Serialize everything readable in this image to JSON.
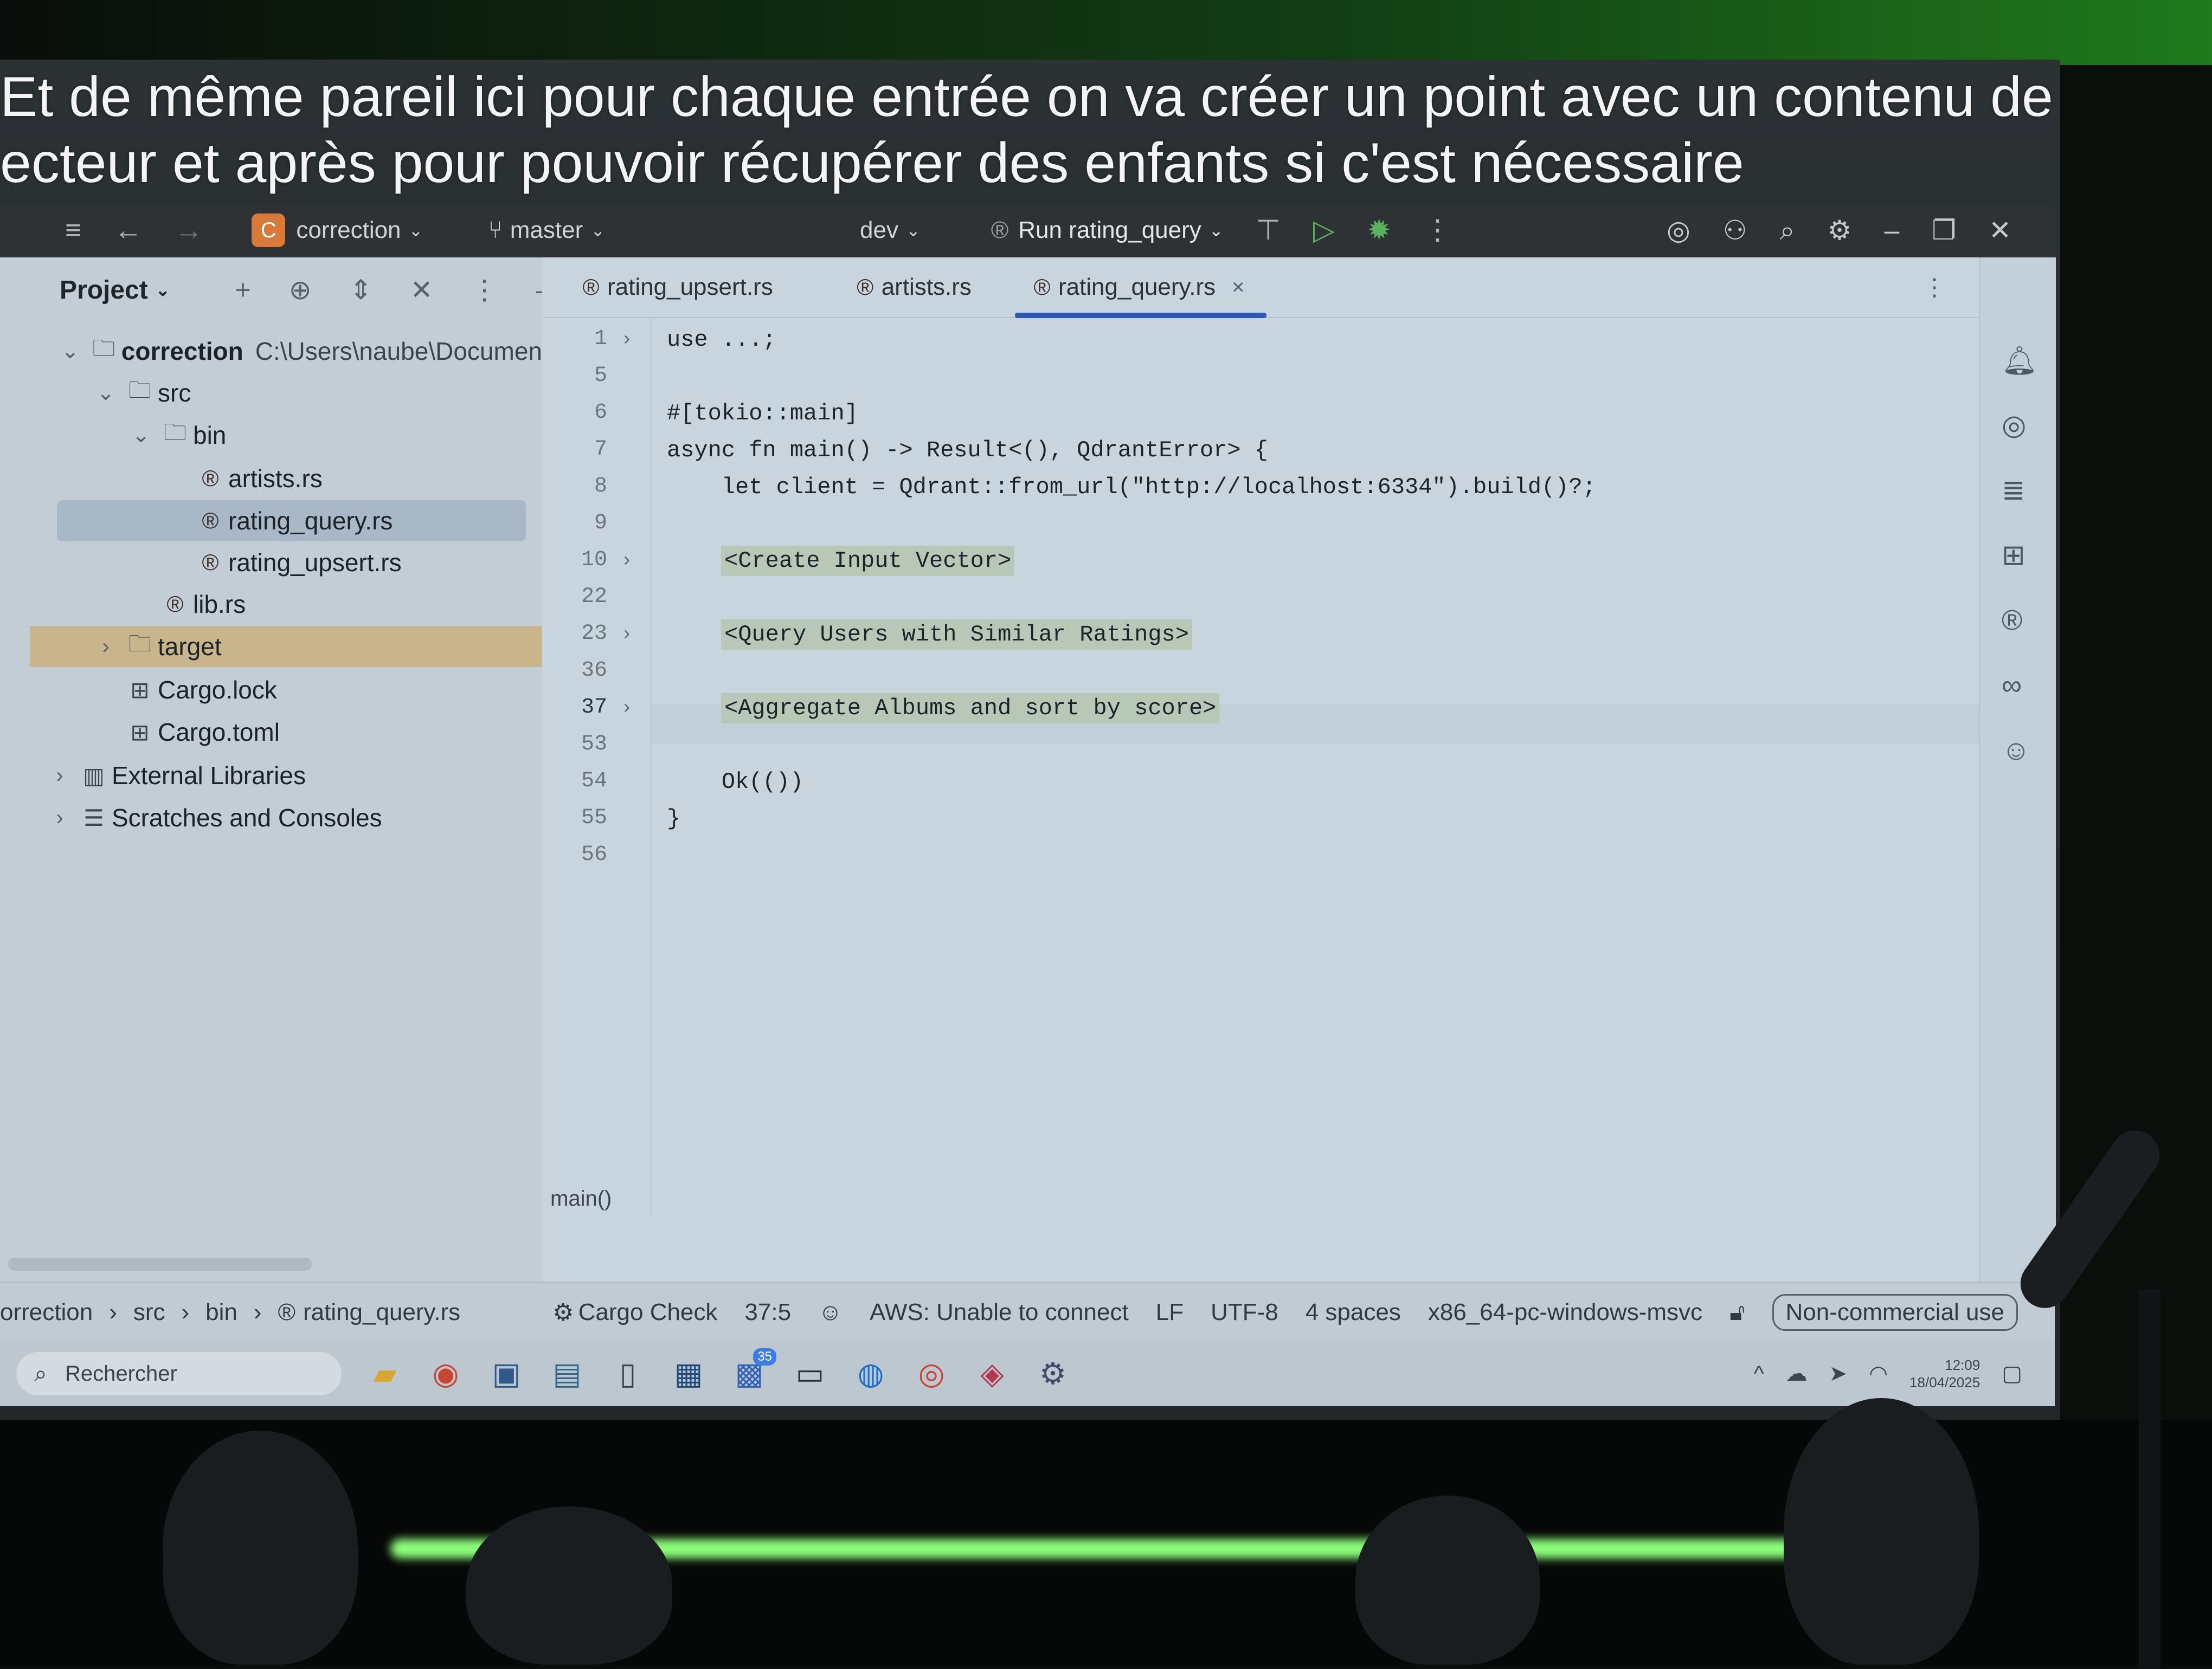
{
  "subtitle": {
    "line1": "Et de même pareil ici pour chaque entrée on va créer un point avec un contenu de",
    "line2": "ecteur et après pour pouvoir récupérer des enfants si c'est nécessaire"
  },
  "titlebar": {
    "project_badge": "C",
    "project": "correction",
    "branch": "master",
    "config": "dev",
    "run_label": "Run rating_query"
  },
  "project_pane": {
    "title": "Project",
    "tree": [
      {
        "label": "correction",
        "path": "C:\\Users\\naube\\Documen"
      },
      {
        "label": "src"
      },
      {
        "label": "bin"
      },
      {
        "label": "artists.rs"
      },
      {
        "label": "rating_query.rs"
      },
      {
        "label": "rating_upsert.rs"
      },
      {
        "label": "lib.rs"
      },
      {
        "label": "target"
      },
      {
        "label": "Cargo.lock"
      },
      {
        "label": "Cargo.toml"
      },
      {
        "label": "External Libraries"
      },
      {
        "label": "Scratches and Consoles"
      }
    ]
  },
  "tabs": [
    {
      "label": "rating_upsert.rs"
    },
    {
      "label": "artists.rs"
    },
    {
      "label": "rating_query.rs",
      "active": true
    }
  ],
  "editor": {
    "lines": [
      {
        "n": "1",
        "text": "use ...;"
      },
      {
        "n": "5",
        "text": ""
      },
      {
        "n": "6",
        "text": "#[tokio::main]"
      },
      {
        "n": "7",
        "text": "async fn main() -> Result<(), QdrantError> {"
      },
      {
        "n": "8",
        "text": "    let client = Qdrant::from_url(\"http://localhost:6334\").build()?;"
      },
      {
        "n": "9",
        "text": ""
      },
      {
        "n": "10",
        "text": "<Create Input Vector>"
      },
      {
        "n": "22",
        "text": ""
      },
      {
        "n": "23",
        "text": "<Query Users with Similar Ratings>"
      },
      {
        "n": "36",
        "text": ""
      },
      {
        "n": "37",
        "text": "<Aggregate Albums and sort by score>"
      },
      {
        "n": "53",
        "text": ""
      },
      {
        "n": "54",
        "text": "    Ok(())"
      },
      {
        "n": "55",
        "text": "}"
      },
      {
        "n": "56",
        "text": ""
      }
    ],
    "code_breadcrumb": "main()"
  },
  "statusbar": {
    "crumb1": "orrection",
    "crumb2": "src",
    "crumb3": "bin",
    "crumb4": "rating_query.rs",
    "cargo_check": "Cargo Check",
    "position": "37:5",
    "aws": "AWS: Unable to connect",
    "line_sep": "LF",
    "encoding": "UTF-8",
    "indent": "4 spaces",
    "target": "x86_64-pc-windows-msvc",
    "license": "Non-commercial use"
  },
  "taskbar": {
    "search_placeholder": "Rechercher",
    "time": "12:09",
    "date": "18/04/2025",
    "teams_badge": "35"
  }
}
